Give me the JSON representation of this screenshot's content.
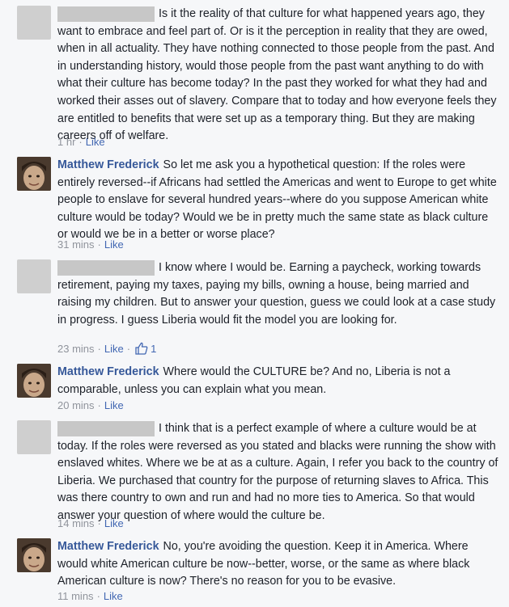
{
  "comments": [
    {
      "author": "",
      "redacted": true,
      "text": "Is it the reality of that culture for what happened years ago, they want to embrace and feel part of. Or is it the perception in reality that they are owed, when in all actuality. They have nothing connected to those people from the past. And in understanding history, would those people from the past want anything to do with what their culture has become today? In the past they worked for what they had and worked their asses out of slavery. Compare that to today and how everyone feels they are entitled to benefits that were set up as a temporary thing. But they are making careers off of welfare.",
      "time": "1 hr",
      "like_label": "Like",
      "likes": ""
    },
    {
      "author": "Matthew Frederick",
      "redacted": false,
      "text": "So let me ask you a hypothetical question: If the roles were entirely reversed--if Africans had settled the Americas and went to Europe to get white people to enslave for several hundred years--where do you suppose American white culture would be today? Would we be in pretty much the same state as black culture or would we be in a better or worse place?",
      "time": "31 mins",
      "like_label": "Like",
      "likes": ""
    },
    {
      "author": "",
      "redacted": true,
      "text": "I know where I would be. Earning a paycheck, working towards retirement, paying my taxes, paying my bills, owning a house, being married and raising my children. But to answer your question, guess we could look at a case study in progress. I guess Liberia would fit the model you are looking for.",
      "time": "23 mins",
      "like_label": "Like",
      "likes": "1"
    },
    {
      "author": "Matthew Frederick",
      "redacted": false,
      "text": "Where would the CULTURE be? And no, Liberia is not a comparable, unless you can explain what you mean.",
      "time": "20 mins",
      "like_label": "Like",
      "likes": ""
    },
    {
      "author": "",
      "redacted": true,
      "text": "I think that is a perfect example of where a culture would be at today. If the roles were reversed as you stated and blacks were running the show with enslaved whites. Where we be at as a culture. Again, I refer you back to the country of Liberia. We purchased that country for the purpose of returning slaves to Africa. This was there country to own and run and had no more ties to America. So that would answer your question of where would the culture be.",
      "time": "14 mins",
      "like_label": "Like",
      "likes": ""
    },
    {
      "author": "Matthew Frederick",
      "redacted": false,
      "text": "No, you're avoiding the question. Keep it in America. Where would white American culture be now--better, worse, or the same as where black American culture is now? There's no reason for you to be evasive.",
      "time": "11 mins",
      "like_label": "Like",
      "likes": ""
    }
  ]
}
